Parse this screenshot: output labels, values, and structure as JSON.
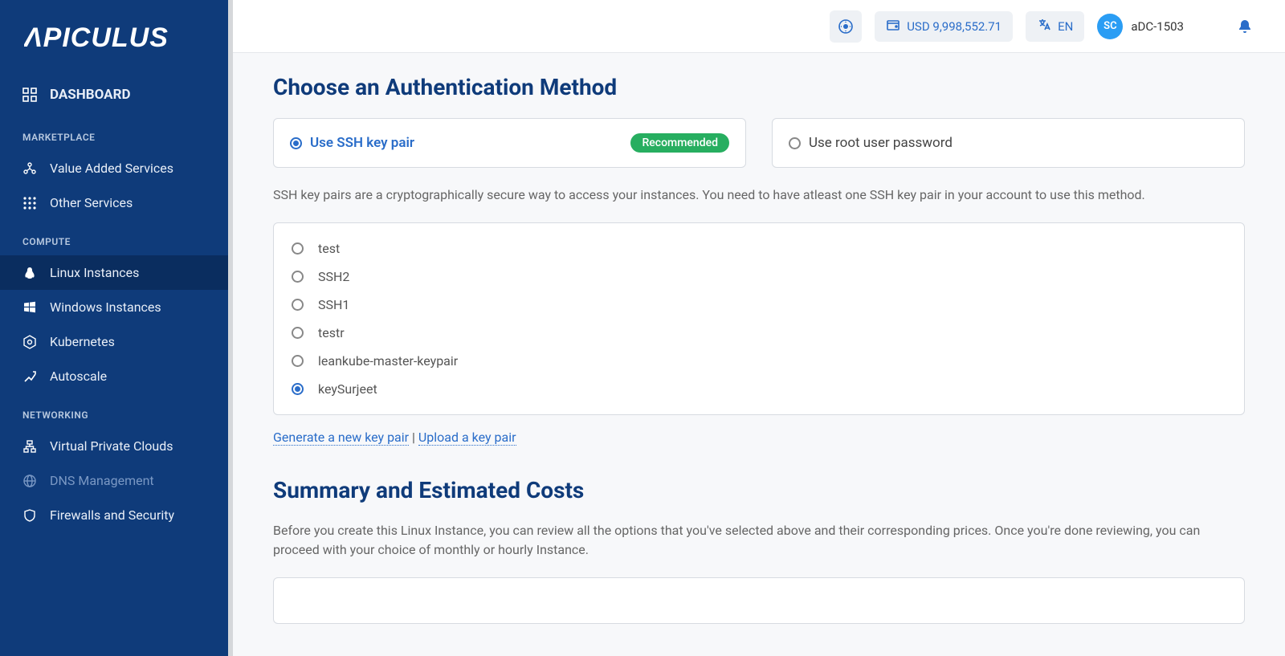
{
  "brand": "APICULUS",
  "header": {
    "balance": "USD 9,998,552.71",
    "language": "EN",
    "avatar_initials": "SC",
    "account": "aDC-1503"
  },
  "sidebar": {
    "dashboard": "DASHBOARD",
    "groups": [
      {
        "label": "MARKETPLACE",
        "items": [
          {
            "key": "value-added-services",
            "label": "Value Added Services"
          },
          {
            "key": "other-services",
            "label": "Other Services"
          }
        ]
      },
      {
        "label": "COMPUTE",
        "items": [
          {
            "key": "linux-instances",
            "label": "Linux Instances",
            "active": true
          },
          {
            "key": "windows-instances",
            "label": "Windows Instances"
          },
          {
            "key": "kubernetes",
            "label": "Kubernetes"
          },
          {
            "key": "autoscale",
            "label": "Autoscale"
          }
        ]
      },
      {
        "label": "NETWORKING",
        "items": [
          {
            "key": "vpc",
            "label": "Virtual Private Clouds"
          },
          {
            "key": "dns",
            "label": "DNS Management",
            "disabled": true
          },
          {
            "key": "firewalls",
            "label": "Firewalls and Security"
          }
        ]
      }
    ]
  },
  "auth": {
    "title": "Choose an Authentication Method",
    "opt_ssh": "Use SSH key pair",
    "opt_root": "Use root user password",
    "recommended": "Recommended",
    "help": "SSH key pairs are a cryptographically secure way to access your instances. You need to have atleast one SSH key pair in your account to use this method.",
    "keys": [
      "test",
      "SSH2",
      "SSH1",
      "testr",
      "leankube-master-keypair",
      "keySurjeet"
    ],
    "selected_key_index": 5,
    "link_generate": "Generate a new key pair",
    "link_upload": "Upload a key pair"
  },
  "summary": {
    "title": "Summary and Estimated Costs",
    "help": "Before you create this Linux Instance, you can review all the options that you've selected above and their corresponding prices. Once you're done reviewing, you can proceed with your choice of monthly or hourly Instance."
  }
}
